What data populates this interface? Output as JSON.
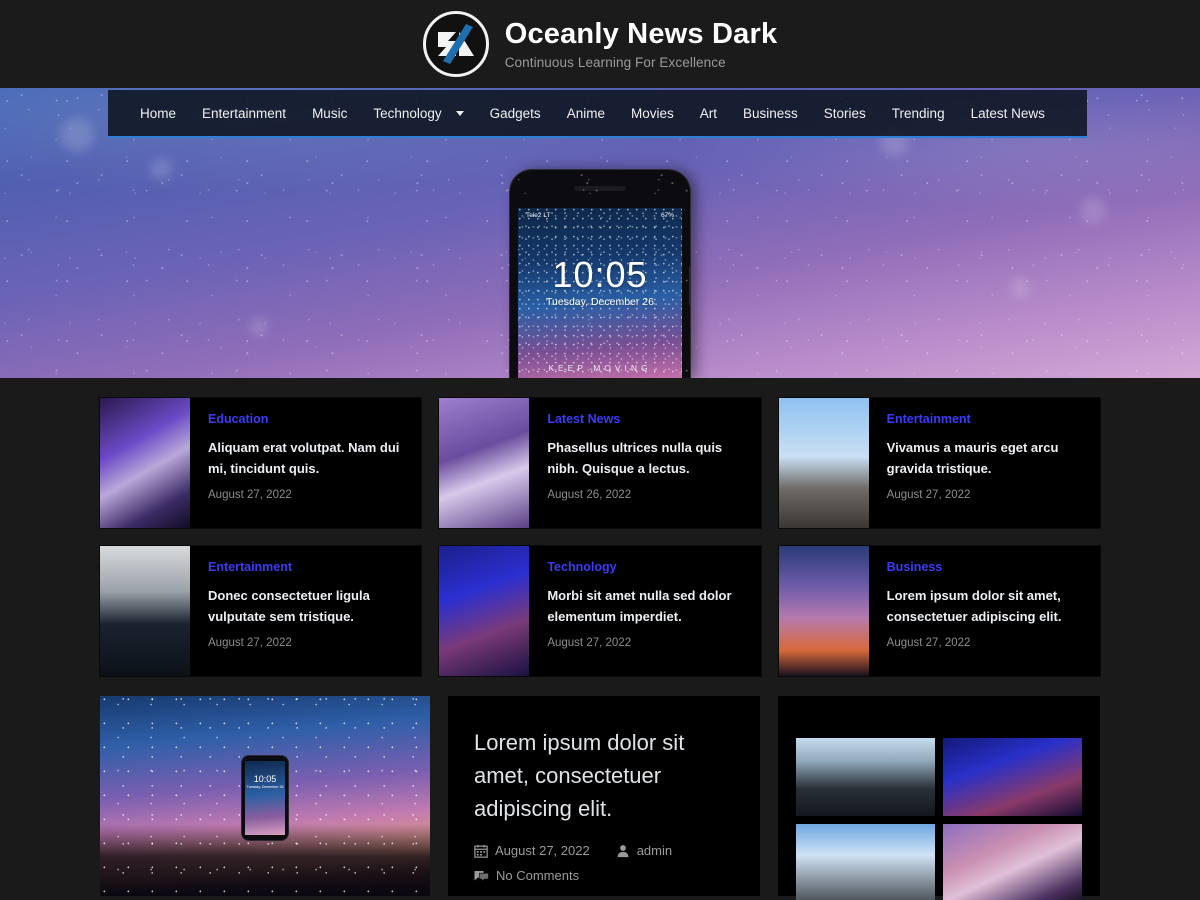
{
  "header": {
    "site_title": "Oceanly News Dark",
    "tagline": "Continuous Learning For Excellence",
    "logo_icon": "oceanly-logo-mark",
    "background_color": "#1b1b1b"
  },
  "nav": {
    "items": [
      {
        "label": "Home",
        "has_dropdown": false
      },
      {
        "label": "Entertainment",
        "has_dropdown": false
      },
      {
        "label": "Music",
        "has_dropdown": false
      },
      {
        "label": "Technology",
        "has_dropdown": true
      },
      {
        "label": "Gadgets",
        "has_dropdown": false
      },
      {
        "label": "Anime",
        "has_dropdown": false
      },
      {
        "label": "Movies",
        "has_dropdown": false
      },
      {
        "label": "Art",
        "has_dropdown": false
      },
      {
        "label": "Business",
        "has_dropdown": false
      },
      {
        "label": "Stories",
        "has_dropdown": false
      },
      {
        "label": "Trending",
        "has_dropdown": false
      },
      {
        "label": "Latest News",
        "has_dropdown": false
      }
    ],
    "accent_color": "#2f7fd6"
  },
  "hero": {
    "phone": {
      "carrier": "Tele2 LT",
      "battery": "67%",
      "time": "10:05",
      "date": "Tuesday, December 26",
      "slogan": "KEEP MOVING"
    }
  },
  "cards": [
    {
      "category": "Education",
      "title": "Aliquam erat volutpat. Nam dui mi, tincidunt quis.",
      "date": "August 27, 2022",
      "thumb_class": "th-edu"
    },
    {
      "category": "Latest News",
      "title": "Phasellus ultrices nulla quis nibh. Quisque a lectus.",
      "date": "August 26, 2022",
      "thumb_class": "th-latest"
    },
    {
      "category": "Entertainment",
      "title": "Vivamus a mauris eget arcu gravida tristique.",
      "date": "August 27, 2022",
      "thumb_class": "th-ent1"
    },
    {
      "category": "Entertainment",
      "title": "Donec consectetuer ligula vulputate sem tristique.",
      "date": "August 27, 2022",
      "thumb_class": "th-ent2"
    },
    {
      "category": "Technology",
      "title": "Morbi sit amet nulla sed dolor elementum imperdiet.",
      "date": "August 27, 2022",
      "thumb_class": "th-tech"
    },
    {
      "category": "Business",
      "title": "Lorem ipsum dolor sit amet, consectetuer adipiscing elit.",
      "date": "August 27, 2022",
      "thumb_class": "th-biz"
    }
  ],
  "feature": {
    "image_alt": "hand-holding-phone-aurora",
    "title": "Lorem ipsum dolor sit amet, consectetuer adipiscing elit.",
    "date": "August 27, 2022",
    "author": "admin",
    "comments": "No Comments",
    "calendar_icon": "calendar-icon",
    "author_icon": "user-icon",
    "comments_icon": "comment-icon"
  },
  "gallery": {
    "tiles": [
      {
        "alt": "city-skyline",
        "class": "g1"
      },
      {
        "alt": "concert-stage",
        "class": "g2"
      },
      {
        "alt": "blue-sky-buildings",
        "class": "g3"
      },
      {
        "alt": "phone-bokeh",
        "class": "g4"
      }
    ]
  },
  "theme": {
    "page_background": "#1a1a1a",
    "card_background": "#000000",
    "category_link_color": "#3b3bf5",
    "muted_text_color": "#8d8d8d"
  }
}
